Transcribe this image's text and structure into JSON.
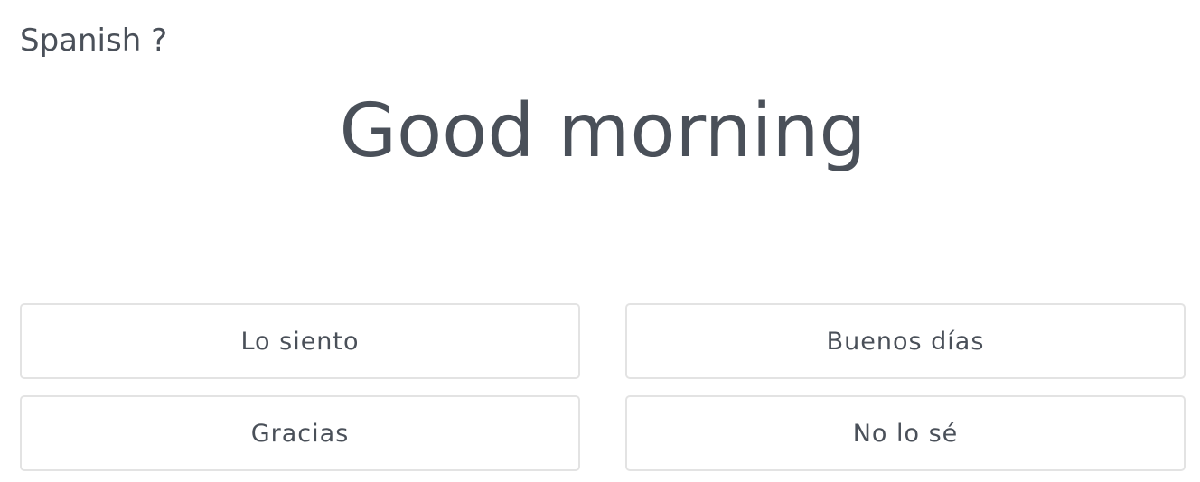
{
  "header": {
    "language_prompt": "Spanish ?"
  },
  "question": {
    "text": "Good morning"
  },
  "answers": [
    {
      "label": "Lo siento"
    },
    {
      "label": "Buenos días"
    },
    {
      "label": "Gracias"
    },
    {
      "label": "No lo sé"
    }
  ]
}
